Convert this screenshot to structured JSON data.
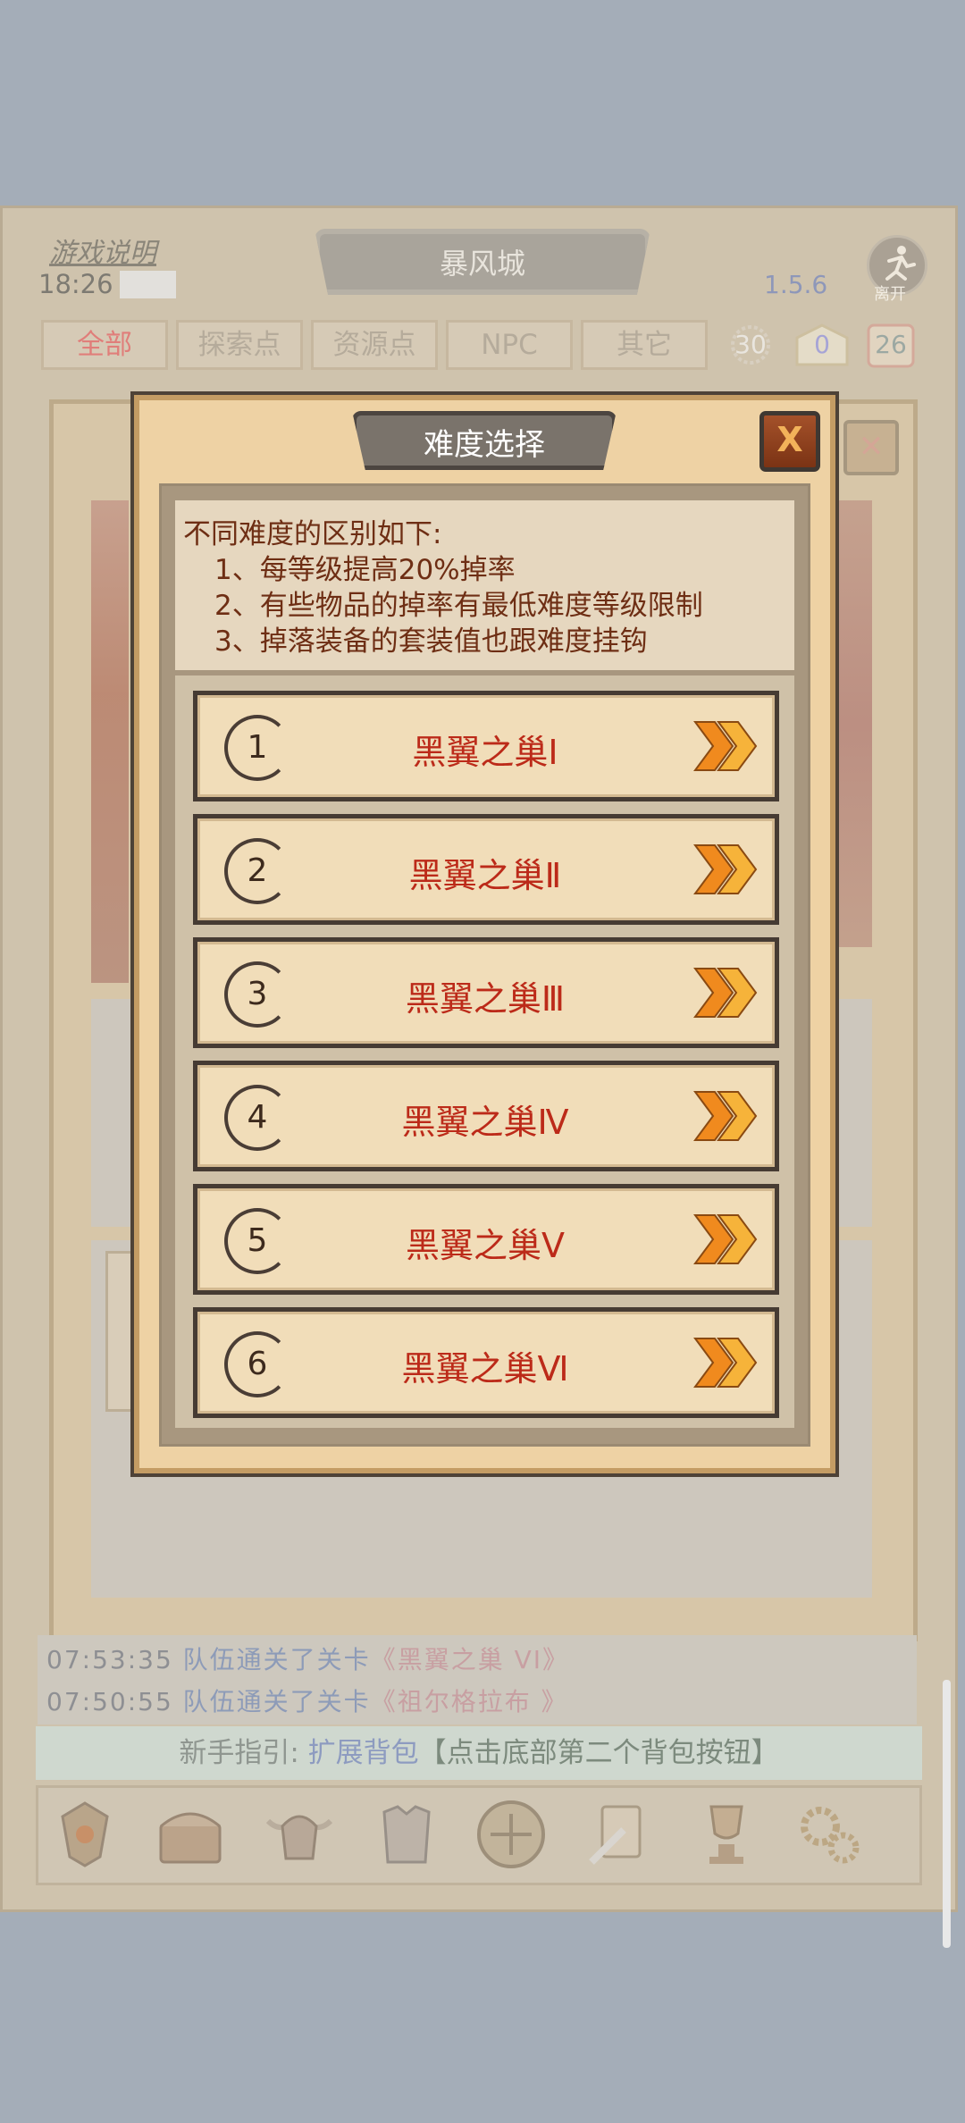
{
  "header": {
    "help_link": "游戏说明",
    "time": "18:26",
    "city": "暴风城",
    "version": "1.5.6",
    "leave_label": "离开"
  },
  "tabs": [
    "全部",
    "探索点",
    "资源点",
    "NPC",
    "其它"
  ],
  "stats": {
    "energy": "30",
    "mail": "0",
    "calendar": "26"
  },
  "log": [
    {
      "time": "07:53:35",
      "text": "队伍通关了关卡",
      "quote": "《黑翼之巢 VI》"
    },
    {
      "time": "07:50:55",
      "text": "队伍通关了关卡",
      "quote": "《祖尔格拉布 》"
    }
  ],
  "guide": {
    "prefix": "新手指引:",
    "action": "扩展背包",
    "detail": "【点击底部第二个背包按钮】"
  },
  "bottom_nav": [
    "rank-emblem-icon",
    "treasure-chest-icon",
    "horned-helmet-icon",
    "armor-icon",
    "rune-disc-icon",
    "quest-scroll-icon",
    "trophy-icon",
    "settings-gears-icon"
  ],
  "modal": {
    "title": "难度选择",
    "close_label": "X",
    "description": {
      "intro": "不同难度的区别如下:",
      "rules": [
        "1、每等级提高20%掉率",
        "2、有些物品的掉率有最低难度等级限制",
        "3、掉落装备的套装值也跟难度挂钩"
      ]
    },
    "levels": [
      {
        "num": "1",
        "name": "黑翼之巢Ⅰ"
      },
      {
        "num": "2",
        "name": "黑翼之巢Ⅱ"
      },
      {
        "num": "3",
        "name": "黑翼之巢Ⅲ"
      },
      {
        "num": "4",
        "name": "黑翼之巢Ⅳ"
      },
      {
        "num": "5",
        "name": "黑翼之巢Ⅴ"
      },
      {
        "num": "6",
        "name": "黑翼之巢Ⅵ"
      }
    ]
  },
  "colors": {
    "level_name": "#bc2a19",
    "desc_text": "#6e2e14",
    "arrow": "#f08a1e"
  }
}
